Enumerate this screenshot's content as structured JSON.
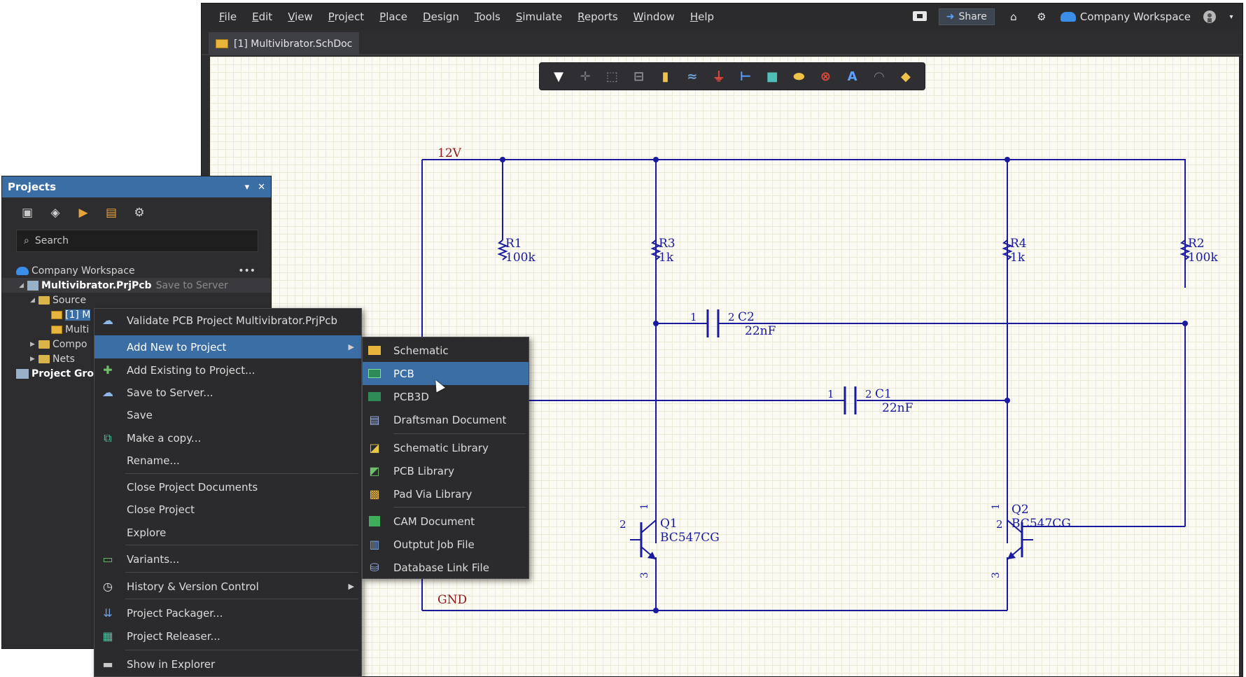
{
  "menubar": {
    "items": [
      "File",
      "Edit",
      "View",
      "Project",
      "Place",
      "Design",
      "Tools",
      "Simulate",
      "Reports",
      "Window",
      "Help"
    ],
    "share_label": "Share",
    "workspace_label": "Company Workspace"
  },
  "document_tab": {
    "label": "[1] Multivibrator.SchDoc"
  },
  "schematic": {
    "net_12v": "12V",
    "net_gnd": "GND",
    "r1": {
      "ref": "R1",
      "value": "100k"
    },
    "r2": {
      "ref": "R2",
      "value": "100k"
    },
    "r3": {
      "ref": "R3",
      "value": "1k"
    },
    "r4": {
      "ref": "R4",
      "value": "1k"
    },
    "c2": {
      "ref": "C2",
      "value": "22nF",
      "pin1": "1",
      "pin2": "2"
    },
    "c1": {
      "ref": "C1",
      "value": "22nF",
      "pin1": "1",
      "pin2": "2"
    },
    "q1": {
      "ref": "Q1",
      "value": "BC547CG",
      "pin1": "1",
      "pin2": "2",
      "pin3": "3"
    },
    "q2": {
      "ref": "Q2",
      "value": "BC547CG",
      "pin1": "1",
      "pin2": "2",
      "pin3": "3"
    }
  },
  "projects_panel": {
    "title": "Projects",
    "search_placeholder": "Search",
    "tree": {
      "workspace": "Company Workspace",
      "project": "Multivibrator.PrjPcb",
      "project_status": "Save to Server",
      "source": "Source",
      "doc1": "[1] M",
      "doc2": "Multi",
      "components": "Compo",
      "nets": "Nets",
      "project_group": "Project Grou"
    }
  },
  "context_menu": {
    "items": [
      {
        "label": "Validate PCB Project Multivibrator.PrjPcb"
      },
      {
        "label": "Add New to Project"
      },
      {
        "label": "Add Existing to Project..."
      },
      {
        "label": "Save to Server..."
      },
      {
        "label": "Save"
      },
      {
        "label": "Make a copy..."
      },
      {
        "label": "Rename..."
      },
      {
        "label": "Close Project Documents"
      },
      {
        "label": "Close Project"
      },
      {
        "label": "Explore"
      },
      {
        "label": "Variants..."
      },
      {
        "label": "History & Version Control"
      },
      {
        "label": "Project Packager..."
      },
      {
        "label": "Project Releaser..."
      },
      {
        "label": "Show in Explorer"
      }
    ]
  },
  "submenu": {
    "items": [
      {
        "label": "Schematic"
      },
      {
        "label": "PCB"
      },
      {
        "label": "PCB3D"
      },
      {
        "label": "Draftsman Document"
      },
      {
        "label": "Schematic Library"
      },
      {
        "label": "PCB Library"
      },
      {
        "label": "Pad Via Library"
      },
      {
        "label": "CAM Document"
      },
      {
        "label": "Outptut Job File"
      },
      {
        "label": "Database Link File"
      }
    ]
  },
  "colors": {
    "accent": "#3b6ea5",
    "wire": "#1a1a9e",
    "net_label": "#8b1a1a",
    "sheet": "#fcfbf3"
  }
}
